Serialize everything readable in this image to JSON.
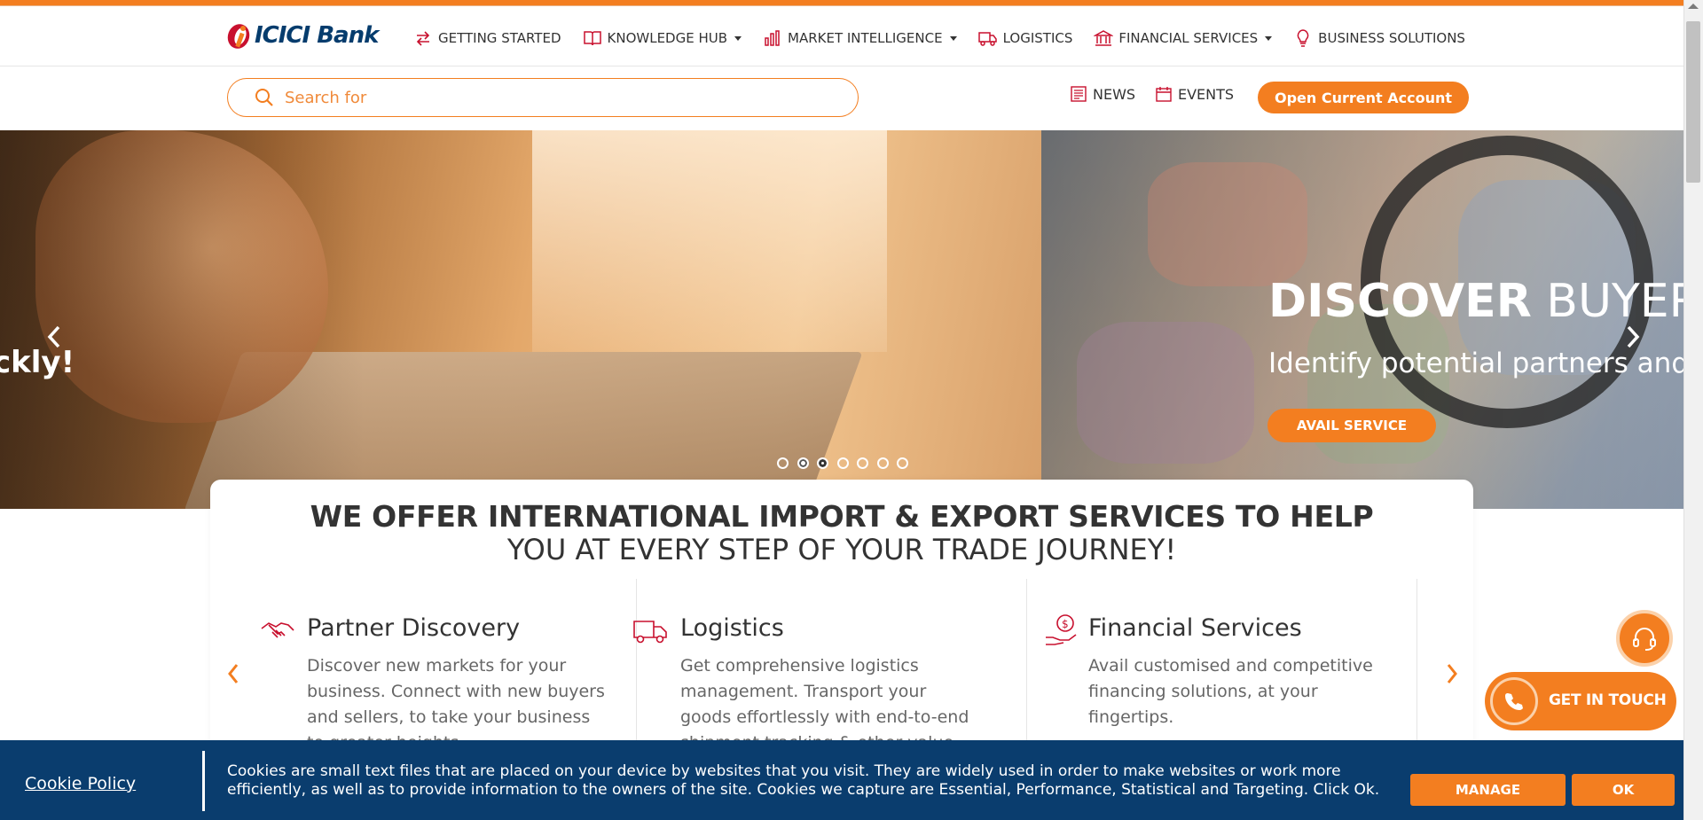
{
  "brand": {
    "name": "ICICI Bank",
    "accent": "#f37e20",
    "navy": "#0a3d6e"
  },
  "nav": [
    {
      "label": "GETTING STARTED",
      "icon": "arrows-exchange-icon",
      "dropdown": false
    },
    {
      "label": "KNOWLEDGE HUB",
      "icon": "open-book-icon",
      "dropdown": true
    },
    {
      "label": "MARKET INTELLIGENCE",
      "icon": "bar-chart-icon",
      "dropdown": true
    },
    {
      "label": "LOGISTICS",
      "icon": "truck-icon",
      "dropdown": false
    },
    {
      "label": "FINANCIAL SERVICES",
      "icon": "bank-building-icon",
      "dropdown": true
    },
    {
      "label": "BUSINESS SOLUTIONS",
      "icon": "lightbulb-icon",
      "dropdown": false
    }
  ],
  "search": {
    "placeholder": "Search for"
  },
  "quick_links": {
    "news": "NEWS",
    "events": "EVENTS"
  },
  "cta": {
    "open_account": "Open Current Account"
  },
  "hero": {
    "left_partial_heading": ")",
    "left_partial_text": "ckly!",
    "title_bold": "DISCOVER",
    "title_light": " BUYERS",
    "subtitle": "Identify potential partners and co",
    "button": "AVAIL SERVICE",
    "slides_count": 7,
    "active_slide": 2
  },
  "offer": {
    "heading_line1": "WE OFFER INTERNATIONAL IMPORT & EXPORT SERVICES TO HELP",
    "heading_line2": "YOU AT EVERY STEP OF YOUR TRADE JOURNEY!",
    "services": [
      {
        "title": "Partner Discovery",
        "icon": "handshake-icon",
        "desc": "Discover new markets for your business. Connect with new buyers and sellers, to take your business to greater heights."
      },
      {
        "title": "Logistics",
        "icon": "delivery-truck-icon",
        "desc": "Get comprehensive logistics management. Transport your goods effortlessly with end-to-end shipment tracking & other value-added services."
      },
      {
        "title": "Financial Services",
        "icon": "money-hand-icon",
        "desc": "Avail customised and competitive financing solutions, at your fingertips."
      }
    ]
  },
  "widgets": {
    "get_in_touch": "GET IN TOUCH"
  },
  "cookie": {
    "policy_link": "Cookie Policy",
    "text": "Cookies are small text files that are placed on your device by websites that you visit. They are widely used in order to make websites or work more efficiently, as well as to provide information to the owners of the site. Cookies we capture are Essential, Performance, Statistical and Targeting. Click Ok.",
    "manage": "MANAGE",
    "ok": "OK"
  }
}
